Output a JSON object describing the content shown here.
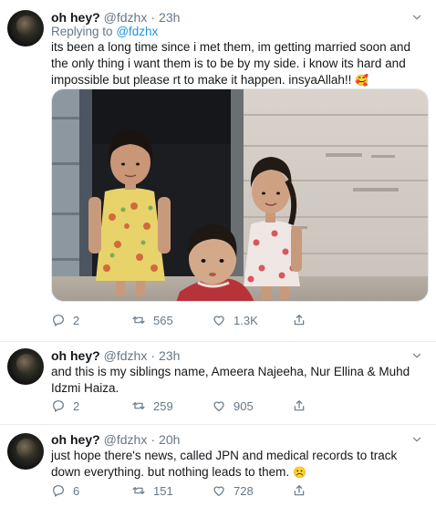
{
  "tweets": [
    {
      "name": "oh hey?",
      "handle": "@fdzhx",
      "separator": "·",
      "time": "23h",
      "replying_prefix": "Replying to",
      "replying_to": "@fdzhx",
      "text": "its been a long time since i met them, im getting married soon and the only thing i want them is to be by my side. i know its hard and impossible but please rt to make it happen. insyaAllah!!",
      "emoji": "🥰",
      "has_photo": true,
      "replies": "2",
      "retweets": "565",
      "likes": "1.3K"
    },
    {
      "name": "oh hey?",
      "handle": "@fdzhx",
      "separator": "·",
      "time": "23h",
      "text": "and this is my siblings name, Ameera Najeeha, Nur Ellina & Muhd Idzmi Haiza.",
      "replies": "2",
      "retweets": "259",
      "likes": "905"
    },
    {
      "name": "oh hey?",
      "handle": "@fdzhx",
      "separator": "·",
      "time": "20h",
      "text": "just hope there's news, called JPN and medical records to track down everything. but nothing leads to them.",
      "emoji": "☹️",
      "replies": "6",
      "retweets": "151",
      "likes": "728"
    }
  ],
  "icons": {
    "reply": "reply-icon",
    "retweet": "retweet-icon",
    "like": "heart-icon",
    "share": "share-icon",
    "more": "chevron-down-icon"
  },
  "colors": {
    "text": "#14171a",
    "secondary": "#657786",
    "link": "#1b95e0",
    "divider": "#e6ecf0"
  }
}
